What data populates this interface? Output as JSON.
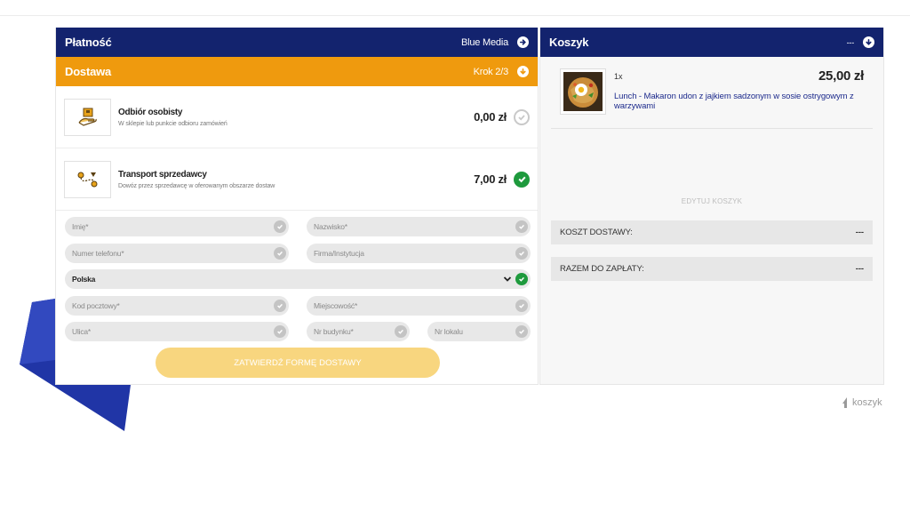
{
  "payment": {
    "title": "Płatność",
    "method": "Blue Media"
  },
  "delivery": {
    "title": "Dostawa",
    "step": "Krok 2/3",
    "options": [
      {
        "name": "Odbiór osobisty",
        "desc": "W sklepie lub punkcie odbioru zamówień",
        "price": "0,00 zł",
        "selected": false,
        "icon": "hand-package-icon"
      },
      {
        "name": "Transport sprzedawcy",
        "desc": "Dowóz przez sprzedawcę w oferowanym obszarze dostaw",
        "price": "7,00 zł",
        "selected": true,
        "icon": "route-icon"
      }
    ]
  },
  "form": {
    "first_name": "Imię*",
    "last_name": "Nazwisko*",
    "phone": "Numer telefonu*",
    "company": "Firma/Instytucja",
    "country": "Polska",
    "postal_code": "Kod pocztowy*",
    "city": "Miejscowość*",
    "street": "Ulica*",
    "building": "Nr budynku*",
    "apartment": "Nr lokalu",
    "submit": "ZATWIERDŹ FORMĘ DOSTAWY"
  },
  "cart": {
    "title": "Koszyk",
    "collapsed_indicator": "---",
    "item": {
      "qty": "1x",
      "price": "25,00 zł",
      "name": "Lunch - Makaron udon z jajkiem sadzonym w sosie ostrygowym z warzywami"
    },
    "edit_label": "EDYTUJ KOSZYK",
    "shipping_label": "KOSZT DOSTAWY:",
    "shipping_value": "---",
    "total_label": "RAZEM DO ZAPŁATY:",
    "total_value": "---"
  },
  "brand": {
    "name": "koszyk"
  },
  "colors": {
    "navy": "#13236e",
    "orange": "#ef9a0e",
    "green": "#1e9a3d",
    "button": "#f8d67f"
  }
}
